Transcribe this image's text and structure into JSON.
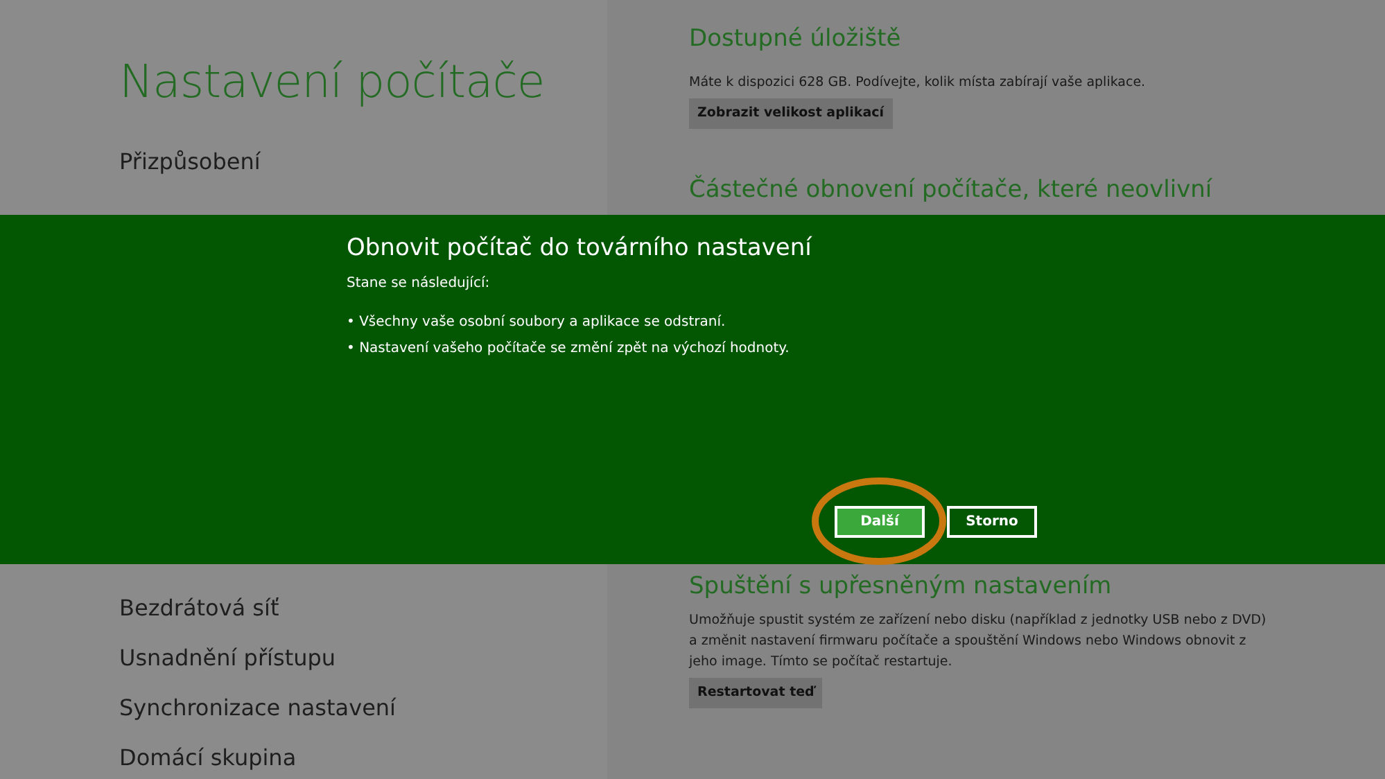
{
  "sidebar": {
    "title": "Nastavení počítače",
    "items_top": [
      {
        "label": "Přizpůsobení"
      }
    ],
    "items_bottom": [
      {
        "label": "Bezdrátová síť"
      },
      {
        "label": "Usnadnění přístupu"
      },
      {
        "label": "Synchronizace nastavení"
      },
      {
        "label": "Domácí skupina"
      }
    ]
  },
  "content": {
    "sections_top": [
      {
        "heading": "Dostupné úložiště",
        "text": "Máte k dispozici 628 GB. Podívejte, kolik místa zabírají vaše aplikace.",
        "button": "Zobrazit velikost aplikací"
      },
      {
        "heading": "Částečné obnovení počítače, které neovlivní"
      }
    ],
    "sections_bottom": [
      {
        "heading": "Spuštění s upřesněným nastavením",
        "text": "Umožňuje spustit systém ze zařízení nebo disku (například z jednotky USB nebo z DVD) a změnit nastavení firmwaru počítače a spouštění Windows nebo Windows obnovit z jeho image. Tímto se počítač restartuje.",
        "button": "Restartovat teď"
      }
    ]
  },
  "dialog": {
    "title": "Obnovit počítač do továrního nastavení",
    "intro": "Stane se následující:",
    "bullets": [
      "• Všechny vaše osobní soubory a aplikace se odstraní.",
      "• Nastavení vašeho počítače se změní zpět na výchozí hodnoty."
    ],
    "buttons": [
      {
        "label": "Další",
        "kind": "primary"
      },
      {
        "label": "Storno",
        "kind": "secondary"
      }
    ]
  },
  "annotation": {
    "kind": "ellipse",
    "color": "#c8780f"
  }
}
